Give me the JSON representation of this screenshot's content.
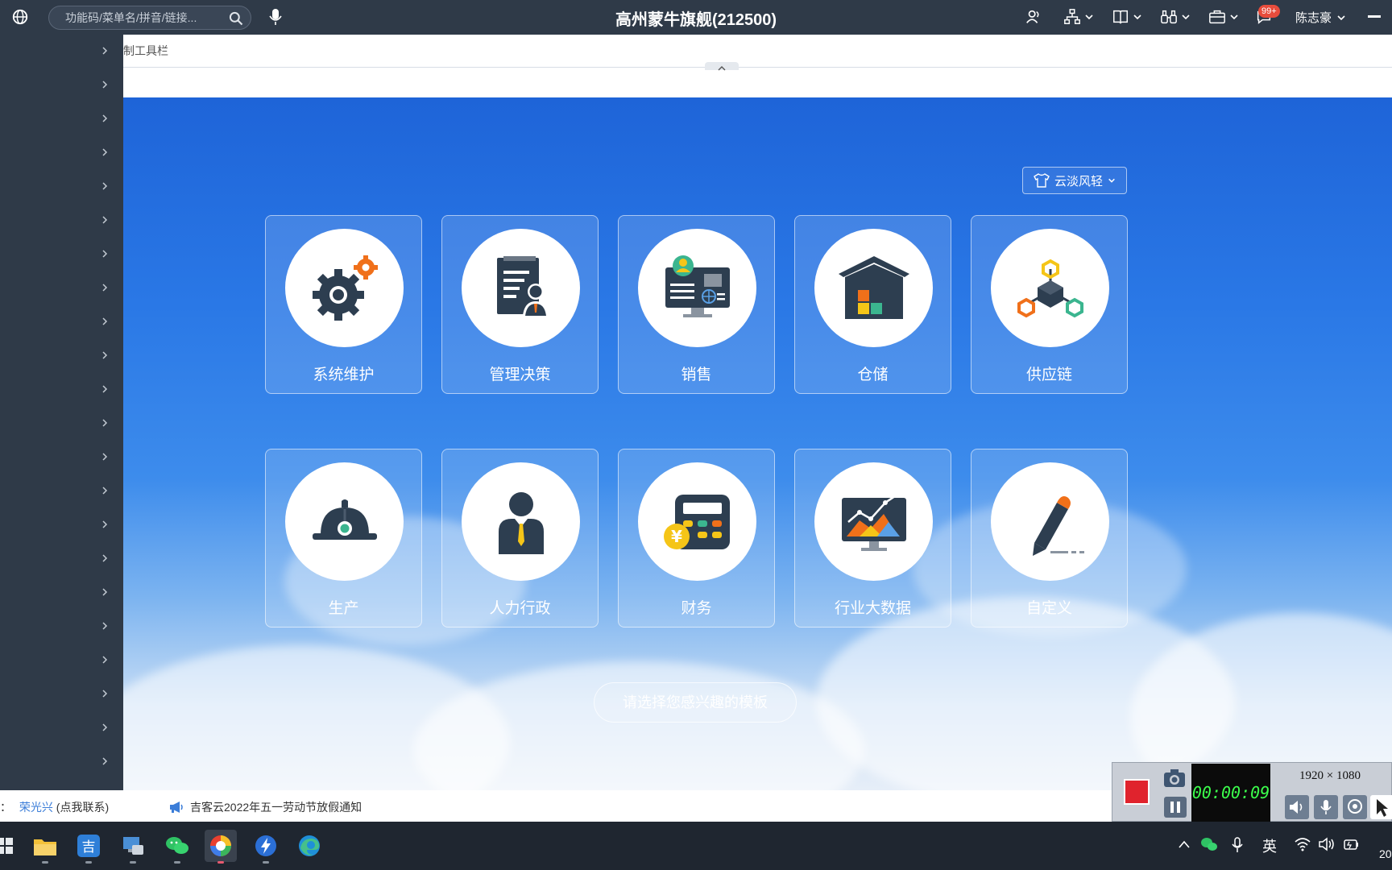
{
  "header": {
    "title": "高州蒙牛旗舰(212500)",
    "search_placeholder": "功能码/菜单名/拼音/链接...",
    "notification_badge": "99+",
    "user_name": "陈志豪"
  },
  "toolbar": {
    "label": "制工具栏"
  },
  "main": {
    "theme_button": "云淡风轻",
    "modules": [
      {
        "label": "系统维护",
        "icon": "gears-icon"
      },
      {
        "label": "管理决策",
        "icon": "document-person-icon"
      },
      {
        "label": "销售",
        "icon": "monitor-contact-icon"
      },
      {
        "label": "仓储",
        "icon": "warehouse-icon"
      },
      {
        "label": "供应链",
        "icon": "supply-chain-icon"
      },
      {
        "label": "生产",
        "icon": "hard-hat-icon"
      },
      {
        "label": "人力行政",
        "icon": "person-tie-icon"
      },
      {
        "label": "财务",
        "icon": "calculator-yen-icon"
      },
      {
        "label": "行业大数据",
        "icon": "chart-monitor-icon"
      },
      {
        "label": "自定义",
        "icon": "pencil-icon"
      }
    ],
    "pick_template": "请选择您感兴趣的模板"
  },
  "notice": {
    "prefix": "：",
    "contact_name": "荣光兴",
    "contact_hint": "(点我联系)",
    "announcement": "吉客云2022年五一劳动节放假通知"
  },
  "recorder": {
    "time": "00:00:09",
    "resolution": "1920 × 1080"
  },
  "taskbar": {
    "ime": "英",
    "clock_fragment": "20"
  },
  "colors": {
    "topbar": "#2f3a48",
    "accent_blue": "#2a78e6",
    "icon_dark": "#2d3e50",
    "icon_orange": "#f0701a",
    "icon_yellow": "#f5c518",
    "icon_teal": "#3bb58f"
  }
}
